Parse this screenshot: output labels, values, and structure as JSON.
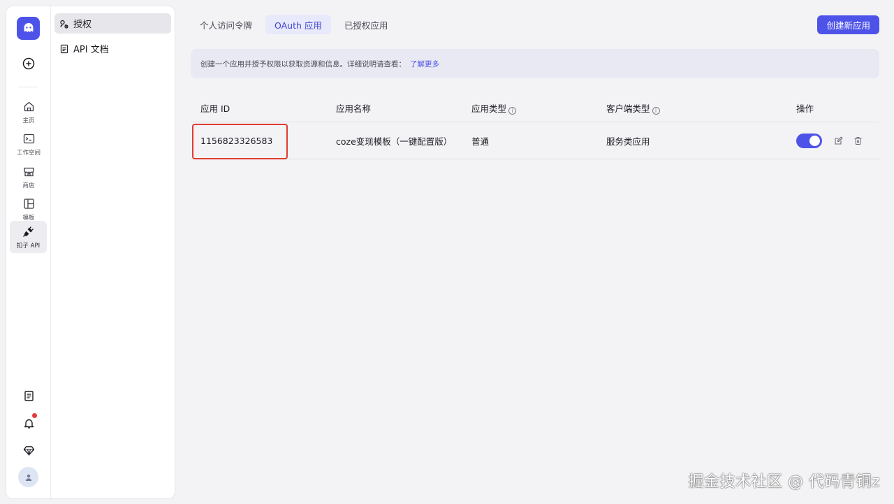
{
  "rail": {
    "nav": [
      {
        "label": "主页",
        "icon": "home-icon"
      },
      {
        "label": "工作空间",
        "icon": "terminal-icon"
      },
      {
        "label": "商店",
        "icon": "store-icon"
      },
      {
        "label": "模板",
        "icon": "template-icon"
      },
      {
        "label": "扣子 API",
        "icon": "plug-icon",
        "active": true
      }
    ]
  },
  "subnav": {
    "items": [
      {
        "label": "授权",
        "icon": "key-icon",
        "active": true
      },
      {
        "label": "API 文档",
        "icon": "document-icon"
      }
    ]
  },
  "tabs": [
    {
      "label": "个人访问令牌"
    },
    {
      "label": "OAuth 应用",
      "active": true
    },
    {
      "label": "已授权应用"
    }
  ],
  "create_button": "创建新应用",
  "banner": {
    "text": "创建一个应用并授予权限以获取资源和信息。详细说明请查看：",
    "link": "了解更多"
  },
  "table": {
    "headers": [
      "应用 ID",
      "应用名称",
      "应用类型",
      "客户端类型",
      "操作"
    ],
    "rows": [
      {
        "id": "1156823326583",
        "name": "coze变现模板（一键配置版）",
        "type": "普通",
        "client_type": "服务类应用",
        "enabled": true
      }
    ]
  },
  "watermark": "掘金技术社区 @ 代码青铜z",
  "colors": {
    "accent": "#4d53e8",
    "highlight_box": "#e23c2f",
    "notification_dot": "#e53935"
  }
}
